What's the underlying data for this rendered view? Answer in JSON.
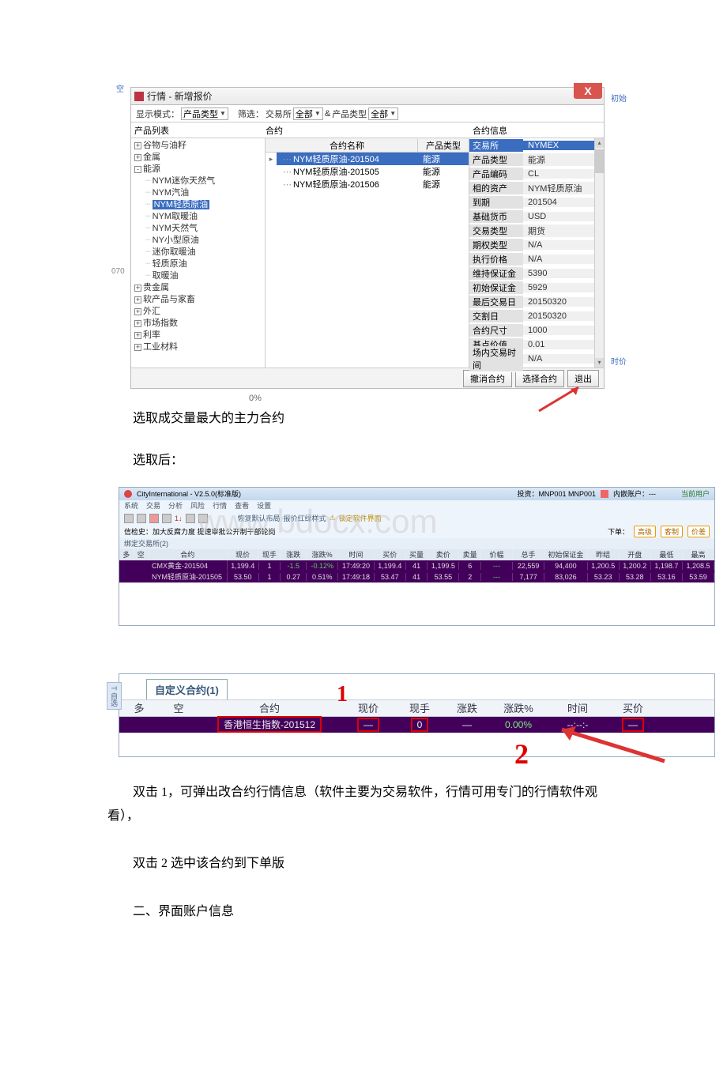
{
  "dialog": {
    "title": "行情 - 新增报价",
    "toolbar": {
      "display_mode_label": "显示模式：",
      "display_mode_value": "产品类型",
      "filter_label": "筛选：",
      "filter_exchange_label": "交易所",
      "filter_exchange_value": "全部",
      "and": "&",
      "product_type_label": "产品类型",
      "product_type_value": "全部"
    },
    "col_headers": {
      "left": "产品列表",
      "mid": "合约",
      "right": "合约信息"
    },
    "tree": [
      {
        "expand": "+",
        "label": "谷物与油籽"
      },
      {
        "expand": "+",
        "label": "金属"
      },
      {
        "expand": "-",
        "label": "能源",
        "children": [
          {
            "label": "NYM迷你天然气"
          },
          {
            "label": "NYM汽油"
          },
          {
            "label": "NYM轻质原油",
            "selected": true
          },
          {
            "label": "NYM取暖油"
          },
          {
            "label": "NYM天然气"
          },
          {
            "label": "NY小型原油"
          },
          {
            "label": "迷你取暖油"
          },
          {
            "label": "轻质原油"
          },
          {
            "label": "取暖油"
          }
        ]
      },
      {
        "expand": "+",
        "label": "贵金属"
      },
      {
        "expand": "+",
        "label": "软产品与家畜"
      },
      {
        "expand": "+",
        "label": "外汇"
      },
      {
        "expand": "+",
        "label": "市场指数"
      },
      {
        "expand": "+",
        "label": "利率"
      },
      {
        "expand": "+",
        "label": "工业材料"
      }
    ],
    "contracts": {
      "headers": {
        "name": "合约名称",
        "type": "产品类型"
      },
      "rows": [
        {
          "name": "NYM轻质原油-201504",
          "type": "能源",
          "selected": true,
          "caret": true
        },
        {
          "name": "NYM轻质原油-201505",
          "type": "能源"
        },
        {
          "name": "NYM轻质原油-201506",
          "type": "能源"
        }
      ]
    },
    "info": [
      {
        "k": "交易所",
        "v": "NYMEX",
        "selected": true
      },
      {
        "k": "产品类型",
        "v": "能源"
      },
      {
        "k": "产品编码",
        "v": "CL"
      },
      {
        "k": "相的资产",
        "v": "NYM轻质原油"
      },
      {
        "k": "到期",
        "v": "201504"
      },
      {
        "k": "基础货币",
        "v": "USD"
      },
      {
        "k": "交易类型",
        "v": "期货"
      },
      {
        "k": "期权类型",
        "v": "N/A"
      },
      {
        "k": "执行价格",
        "v": "N/A"
      },
      {
        "k": "维持保证金",
        "v": "5390"
      },
      {
        "k": "初始保证金",
        "v": "5929"
      },
      {
        "k": "最后交易日",
        "v": "20150320"
      },
      {
        "k": "交割日",
        "v": "20150320"
      },
      {
        "k": "合约尺寸",
        "v": "1000"
      },
      {
        "k": "基点价值",
        "v": "0.01"
      },
      {
        "k": "场内交易时间",
        "v": "N/A"
      }
    ],
    "buttons": {
      "clear": "撤消合约",
      "select": "选择合约",
      "exit": "退出"
    },
    "progress": "0%"
  },
  "surround": {
    "right1": "初始",
    "right2": "时价",
    "left_num": "070"
  },
  "text": {
    "p1": "选取成交量最大的主力合约",
    "p2": "选取后：",
    "p3a": "双击 1，可弹出改合约行情信息（软件主要为交易软件，行情可用专门的行情软件观看），",
    "p4": "双击 2 选中该合约到下单版",
    "p5": "二、界面账户信息"
  },
  "app2": {
    "title": "CityInternational - V2.5.0(标准版)",
    "menu": [
      "系统",
      "交易",
      "分析",
      "风险",
      "行情",
      "查看",
      "设置"
    ],
    "acct_label": "投资：MNP001 MNP001",
    "acct2": "内嵌账户：---",
    "right_btn": "当前用户",
    "toolbar_text": [
      "恢复默认布局",
      "报价红绿样式",
      "锁定软件界面"
    ],
    "subbar": "信检史：加大反腐力度 提速审批公开制干部轮岗",
    "subbar_right": [
      "下单：",
      "高级",
      "客制",
      "价差"
    ],
    "tab": "绑定交易所(2)",
    "grid_headers": [
      "多",
      "空",
      "合约",
      "现价",
      "现手",
      "涨跌",
      "涨跌%",
      "时间",
      "买价",
      "买量",
      "卖价",
      "卖量",
      "价幅",
      "总手",
      "初始保证金",
      "昨结",
      "开盘",
      "最低",
      "最高"
    ],
    "rows": [
      {
        "name": "CMX黄金-201504",
        "vals": [
          "1,199.4",
          "1",
          "-1.5",
          "-0.12%",
          "17:49:20",
          "1,199.4",
          "41",
          "1,199.5",
          "6",
          "---",
          "22,559",
          "94,400",
          "1,200.5",
          "1,200.2",
          "1,198.7",
          "1,208.5"
        ]
      },
      {
        "name": "NYM轻质原油-201505",
        "vals": [
          "53.50",
          "1",
          "0.27",
          "0.51%",
          "17:49:18",
          "53.47",
          "41",
          "53.55",
          "2",
          "---",
          "7,177",
          "83,026",
          "53.23",
          "53.28",
          "53.16",
          "53.59"
        ]
      }
    ],
    "watermark": "www.bdocx.com"
  },
  "app3": {
    "side": "T 自选",
    "tab": "自定义合约(1)",
    "headers": [
      "多",
      "空",
      "合约",
      "现价",
      "现手",
      "涨跌",
      "涨跌%",
      "时间",
      "买价"
    ],
    "row": {
      "name": "香港恒生指数-201512",
      "price": "—",
      "vol": "0",
      "chg": "—",
      "chgp": "0.00%",
      "time": "--:--:-",
      "bid": "—"
    },
    "anno1": "1",
    "anno2": "2"
  }
}
